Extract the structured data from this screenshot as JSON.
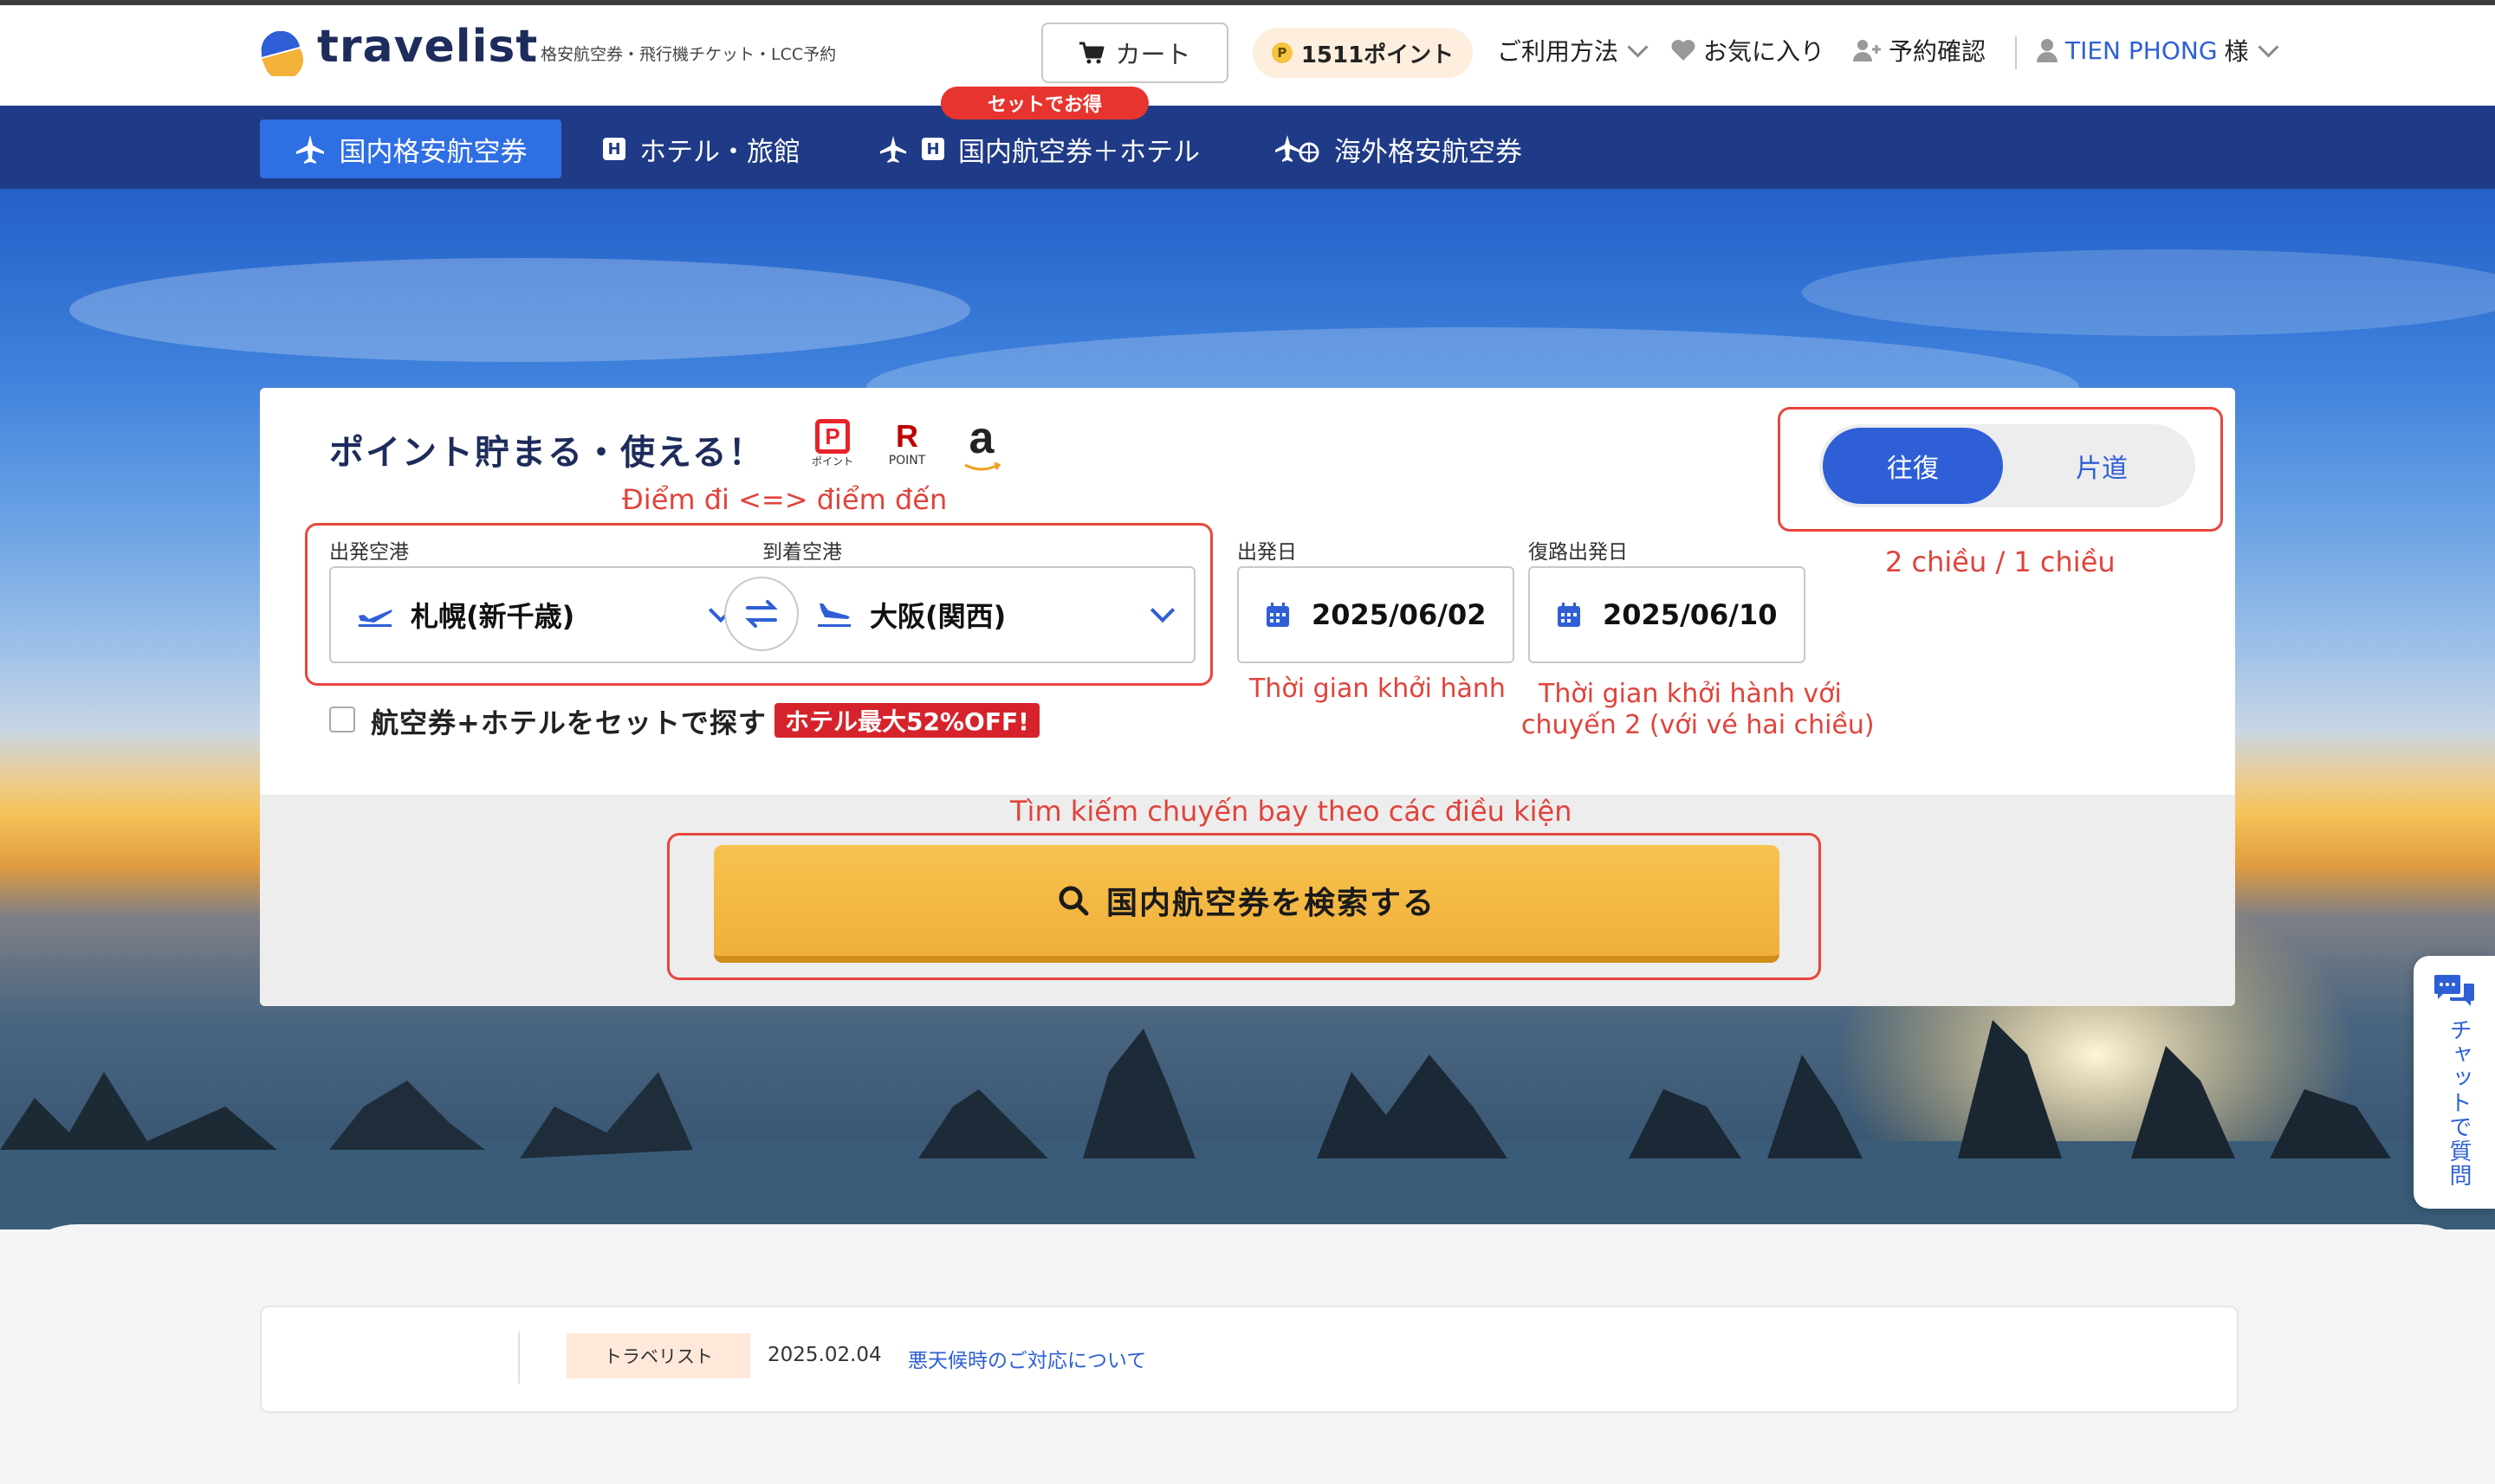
{
  "header": {
    "logo_text": "travelist",
    "tagline": "格安航空券・飛行機チケット・LCC予約",
    "cart_label": "カート",
    "points_label": "1511ポイント",
    "points_coin": "P",
    "usage_label": "ご利用方法",
    "favorites_label": "お気に入り",
    "booking_label": "予約確認",
    "user_label": "TIEN PHONG",
    "user_suffix": "様"
  },
  "nav": {
    "tabs": [
      {
        "label": "国内格安航空券",
        "active": true
      },
      {
        "label": "ホテル・旅館"
      },
      {
        "label": "国内航空券＋ホテル"
      },
      {
        "label": "海外格安航空券"
      }
    ],
    "set_badge": "セットでお得",
    "hotel_icon_letter": "H"
  },
  "search": {
    "promo_text": "ポイント貯まる・使える！",
    "paypay_label": "ポイント",
    "rpoint_letter": "R",
    "rpoint_label": "POINT",
    "amazon_letter": "a",
    "departure_label": "出発空港",
    "departure_value": "札幌(新千歳)",
    "arrival_label": "到着空港",
    "arrival_value": "大阪(関西)",
    "depart_date_label": "出発日",
    "depart_date_value": "2025/06/02",
    "return_date_label": "復路出発日",
    "return_date_value": "2025/06/10",
    "round_trip_label": "往復",
    "one_way_label": "片道",
    "combo_label": "航空券+ホテルをセットで探す",
    "combo_badge": "ホテル最大52%OFF!",
    "search_button_label": "国内航空券を検索する"
  },
  "annotations": {
    "airports": "Điểm đi <=> điểm đến",
    "trip_type": "2 chiều / 1 chiều",
    "depart_date": "Thời gian khởi hành",
    "return_date_line1": "Thời gian khởi hành với",
    "return_date_line2": "chuyến 2 (với vé hai chiều)",
    "search": "Tìm kiếm chuyến bay theo các điều kiện"
  },
  "chat": {
    "label": "チャットで質問"
  },
  "news": {
    "tag": "トラベリスト",
    "date": "2025.02.04",
    "link": "悪天候時のご対応について"
  },
  "colors": {
    "brand_navy": "#1f3a86",
    "accent_blue": "#2e5fd6",
    "search_yellow": "#f0b03a",
    "annotation_red": "#e8453c",
    "badge_red": "#d6232b"
  }
}
